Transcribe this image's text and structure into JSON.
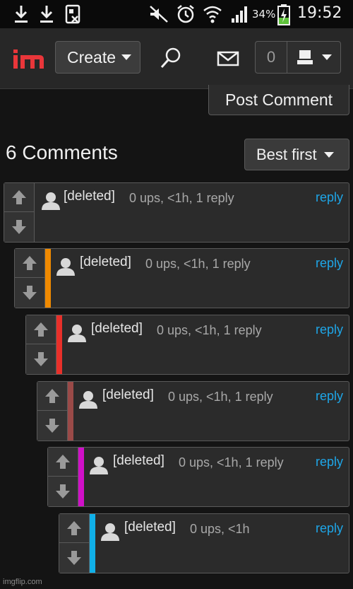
{
  "status_bar": {
    "battery_percent": "34%",
    "time": "19:52"
  },
  "header": {
    "logo_text": "im",
    "create_label": "Create",
    "notification_count": "0"
  },
  "post_comment_label": "Post Comment",
  "comments_heading": "6 Comments",
  "sort_label": "Best first",
  "comments": [
    {
      "author": "[deleted]",
      "meta": "0 ups, <1h, 1 reply",
      "reply_label": "reply",
      "depth_color": ""
    },
    {
      "author": "[deleted]",
      "meta": "0 ups, <1h, 1 reply",
      "reply_label": "reply",
      "depth_color": "#f08a00"
    },
    {
      "author": "[deleted]",
      "meta": "0 ups, <1h, 1 reply",
      "reply_label": "reply",
      "depth_color": "#e8302a"
    },
    {
      "author": "[deleted]",
      "meta": "0 ups, <1h, 1 reply",
      "reply_label": "reply",
      "depth_color": "#9a4a48"
    },
    {
      "author": "[deleted]",
      "meta": "0 ups, <1h, 1 reply",
      "reply_label": "reply",
      "depth_color": "#d010c8"
    },
    {
      "author": "[deleted]",
      "meta": "0 ups, <1h",
      "reply_label": "reply",
      "depth_color": "#10b0e8"
    }
  ],
  "watermark": "imgflip.com"
}
